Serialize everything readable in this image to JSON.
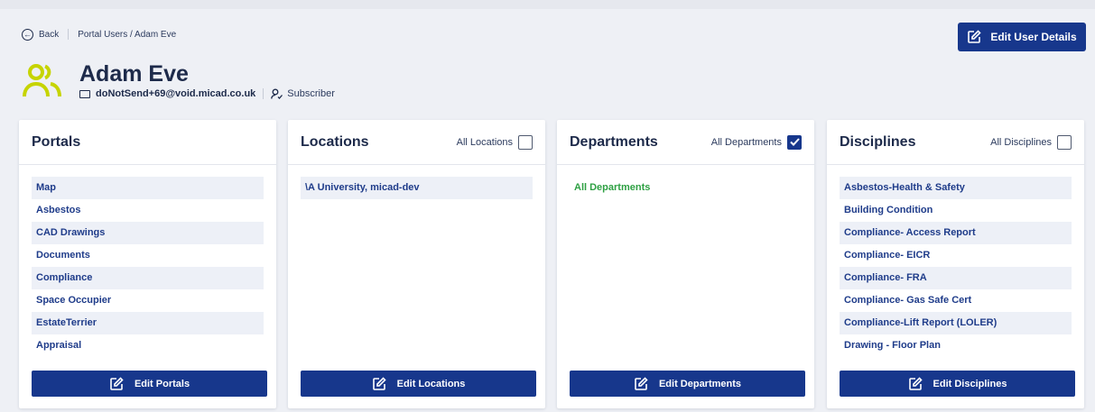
{
  "breadcrumb": {
    "back_label": "Back",
    "path": "Portal Users / Adam Eve"
  },
  "header": {
    "edit_user_label": "Edit User Details",
    "name": "Adam Eve",
    "email": "doNotSend+69@void.micad.co.uk",
    "role": "Subscriber"
  },
  "colors": {
    "primary": "#17378c",
    "avatar": "#c6d400",
    "green": "#2ea043"
  },
  "panels": {
    "portals": {
      "title": "Portals",
      "items": [
        "Map",
        "Asbestos",
        "CAD Drawings",
        "Documents",
        "Compliance",
        "Space Occupier",
        "EstateTerrier",
        "Appraisal"
      ],
      "button": "Edit Portals"
    },
    "locations": {
      "title": "Locations",
      "check_label": "All Locations",
      "checked": false,
      "items": [
        "\\A University, micad-dev"
      ],
      "button": "Edit Locations"
    },
    "departments": {
      "title": "Departments",
      "check_label": "All Departments",
      "checked": true,
      "items": [
        "All Departments"
      ],
      "button": "Edit Departments"
    },
    "disciplines": {
      "title": "Disciplines",
      "check_label": "All Disciplines",
      "checked": false,
      "items": [
        "Asbestos-Health & Safety",
        "Building Condition",
        "Compliance- Access Report",
        "Compliance- EICR",
        "Compliance- FRA",
        "Compliance- Gas Safe Cert",
        "Compliance-Lift Report (LOLER)",
        "Drawing - Floor Plan"
      ],
      "button": "Edit Disciplines"
    }
  }
}
